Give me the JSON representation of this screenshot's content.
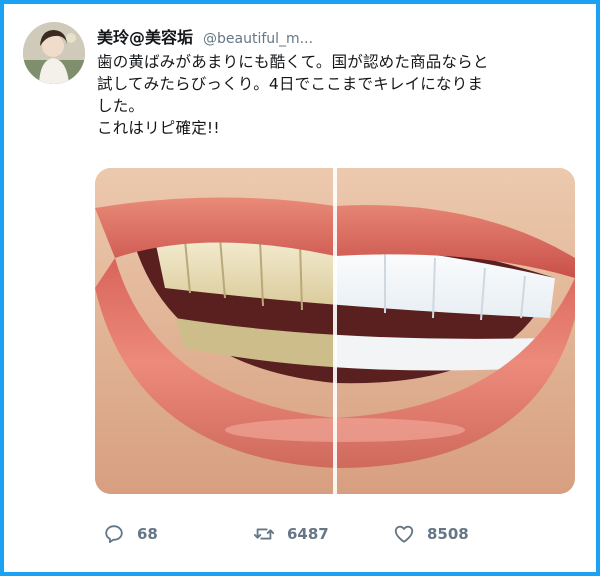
{
  "colors": {
    "frame": "#1da1f2",
    "text": "#14171a",
    "muted": "#657786"
  },
  "tweet": {
    "display_name": "美玲@美容垢",
    "handle": "@beautiful_m...",
    "text_lines": [
      "歯の黄ばみがあまりにも酷くて。国が認めた商品ならと",
      "試してみたらびっくり。4日でここまでキレイになりま",
      "した。",
      "これはリピ確定!!"
    ],
    "media_icon": "teeth-before-after-photo"
  },
  "actions": {
    "replies": "68",
    "retweets": "6487",
    "likes": "8508",
    "reply_icon": "reply-icon",
    "retweet_icon": "retweet-icon",
    "like_icon": "heart-icon"
  }
}
